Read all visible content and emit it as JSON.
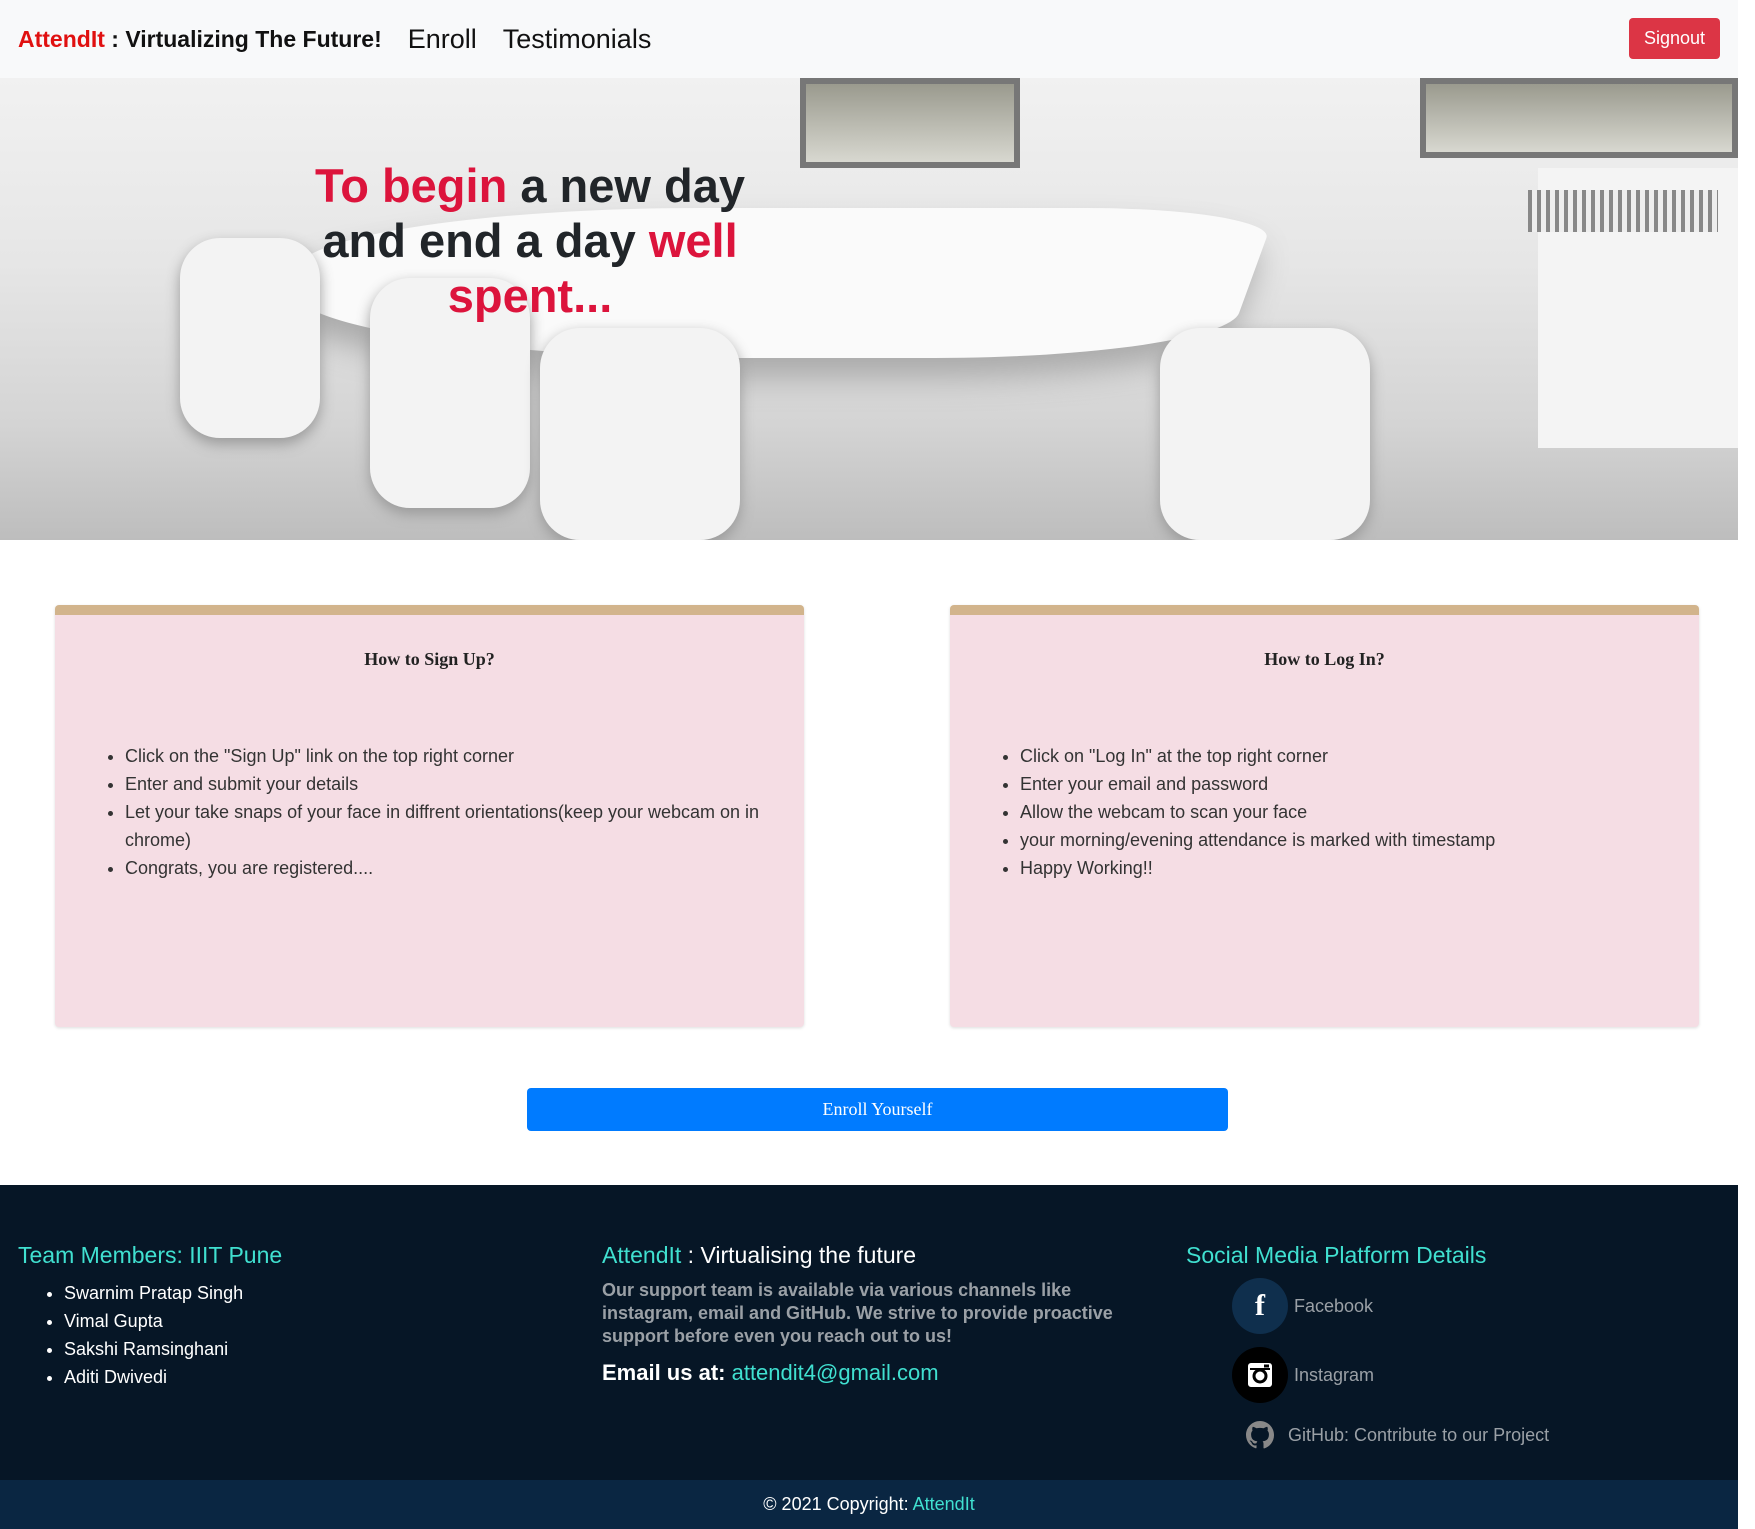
{
  "navbar": {
    "brand_name": "AttendIt",
    "brand_tagline": " : Virtualizing The Future!",
    "links": [
      "Enroll",
      "Testimonials"
    ],
    "signout_label": "Signout",
    "brand_color": "#e01010"
  },
  "hero": {
    "line1_red": "To begin",
    "line1_dark": " a new day",
    "line2_dark": "and end a day ",
    "line2_red": "well",
    "line3_red": "spent..."
  },
  "cards": [
    {
      "title": "How to Sign Up?",
      "items": [
        "Click on the \"Sign Up\" link on the top right corner",
        "Enter and submit your details",
        "Let your take snaps of your face in diffrent orientations(keep your webcam on in chrome)",
        "Congrats, you are registered...."
      ]
    },
    {
      "title": "How to Log In?",
      "items": [
        "Click on \"Log In\" at the top right corner",
        "Enter your email and password",
        "Allow the webcam to scan your face",
        "your morning/evening attendance is marked with timestamp",
        "Happy Working!!"
      ]
    }
  ],
  "enroll_button": "Enroll Yourself",
  "footer": {
    "team_heading": "Team Members: IIIT Pune",
    "team": [
      "Swarnim Pratap Singh",
      "Vimal Gupta",
      "Sakshi Ramsinghani",
      "Aditi Dwivedi"
    ],
    "about_brand": "AttendIt",
    "about_heading": " : Virtualising the future",
    "about_text": "Our support team is available via various channels like instagram, email and GitHub. We strive to provide proactive support before even you reach out to us!",
    "email_label": "Email us at: ",
    "email": "attendit4@gmail.com",
    "social_heading": "Social Media Platform Details",
    "social": [
      {
        "icon": "facebook-icon",
        "label": "Facebook"
      },
      {
        "icon": "instagram-icon",
        "label": "Instagram"
      },
      {
        "icon": "github-icon",
        "label": "GitHub: Contribute to our Project"
      }
    ]
  },
  "copyright": {
    "text": "© 2021 Copyright: ",
    "brand": "AttendIt"
  },
  "colors": {
    "accent": "#40e0d0",
    "danger": "#dc3545",
    "primary": "#007bff",
    "footer_bg": "#061626"
  }
}
